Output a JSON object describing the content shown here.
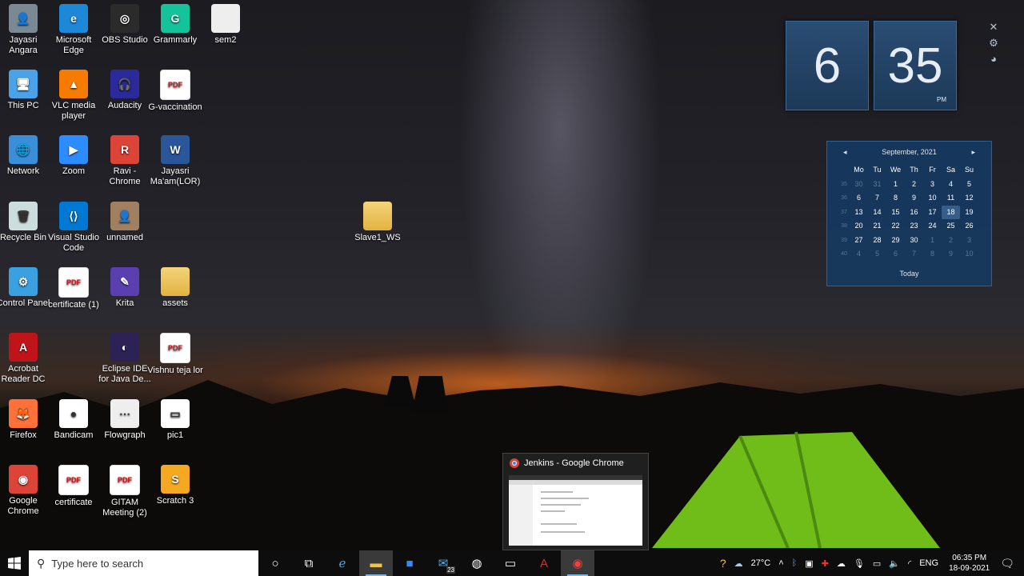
{
  "desktop_icons": [
    {
      "label": "Jayasri Angara",
      "glyph": "👤"
    },
    {
      "label": "Microsoft Edge",
      "glyph": "e"
    },
    {
      "label": "OBS Studio",
      "glyph": "◎"
    },
    {
      "label": "Grammarly",
      "glyph": "G"
    },
    {
      "label": "sem2",
      "glyph": ""
    },
    {
      "label": "This PC",
      "glyph": "🖥"
    },
    {
      "label": "VLC media player",
      "glyph": "▲"
    },
    {
      "label": "Audacity",
      "glyph": "🎧"
    },
    {
      "label": "G-vaccination",
      "glyph": "PDF"
    },
    {
      "label": "Network",
      "glyph": "🌐"
    },
    {
      "label": "Zoom",
      "glyph": "▶"
    },
    {
      "label": "Ravi - Chrome",
      "glyph": "R"
    },
    {
      "label": "Jayasri Ma'am(LOR)",
      "glyph": "W"
    },
    {
      "label": "Recycle Bin",
      "glyph": "🗑"
    },
    {
      "label": "Visual Studio Code",
      "glyph": "⟨⟩"
    },
    {
      "label": "unnamed",
      "glyph": "👤"
    },
    {
      "label": "Slave1_WS",
      "glyph": ""
    },
    {
      "label": "Control Panel",
      "glyph": "⚙"
    },
    {
      "label": "certificate (1)",
      "glyph": "PDF"
    },
    {
      "label": "Krita",
      "glyph": "✎"
    },
    {
      "label": "assets",
      "glyph": ""
    },
    {
      "label": "Acrobat Reader DC",
      "glyph": "A"
    },
    {
      "label": "Eclipse IDE for Java De...",
      "glyph": "◐"
    },
    {
      "label": "Vishnu teja lor",
      "glyph": "PDF"
    },
    {
      "label": "Firefox",
      "glyph": "🦊"
    },
    {
      "label": "Bandicam",
      "glyph": "●"
    },
    {
      "label": "Flowgraph",
      "glyph": "⋯"
    },
    {
      "label": "pic1",
      "glyph": "▭"
    },
    {
      "label": "Google Chrome",
      "glyph": "◉"
    },
    {
      "label": "certificate",
      "glyph": "PDF"
    },
    {
      "label": "GITAM Meeting (2)",
      "glyph": "PDF"
    },
    {
      "label": "Scratch 3",
      "glyph": "S"
    }
  ],
  "clock_widget": {
    "hour": "6",
    "minute": "35",
    "ampm": "PM"
  },
  "calendar": {
    "month": "September, 2021",
    "weekdays": [
      "Mo",
      "Tu",
      "We",
      "Th",
      "Fr",
      "Sa",
      "Su"
    ],
    "weeks": [
      {
        "wk": "35",
        "days": [
          "30",
          "31",
          "1",
          "2",
          "3",
          "4",
          "5"
        ]
      },
      {
        "wk": "36",
        "days": [
          "6",
          "7",
          "8",
          "9",
          "10",
          "11",
          "12"
        ]
      },
      {
        "wk": "37",
        "days": [
          "13",
          "14",
          "15",
          "16",
          "17",
          "18",
          "19"
        ]
      },
      {
        "wk": "38",
        "days": [
          "20",
          "21",
          "22",
          "23",
          "24",
          "25",
          "26"
        ]
      },
      {
        "wk": "39",
        "days": [
          "27",
          "28",
          "29",
          "30",
          "1",
          "2",
          "3"
        ]
      },
      {
        "wk": "40",
        "days": [
          "4",
          "5",
          "6",
          "7",
          "8",
          "9",
          "10"
        ]
      }
    ],
    "today_label": "Today"
  },
  "preview": {
    "title": "Jenkins - Google Chrome"
  },
  "taskbar": {
    "search_placeholder": "Type here to search",
    "weather": "27°C",
    "language": "ENG",
    "time": "06:35 PM",
    "date": "18-09-2021",
    "mail_badge": "23"
  },
  "colors": {
    "accent": "#1c3958",
    "taskbar": "#0d0d0d",
    "pdf_red": "#d0141b"
  }
}
